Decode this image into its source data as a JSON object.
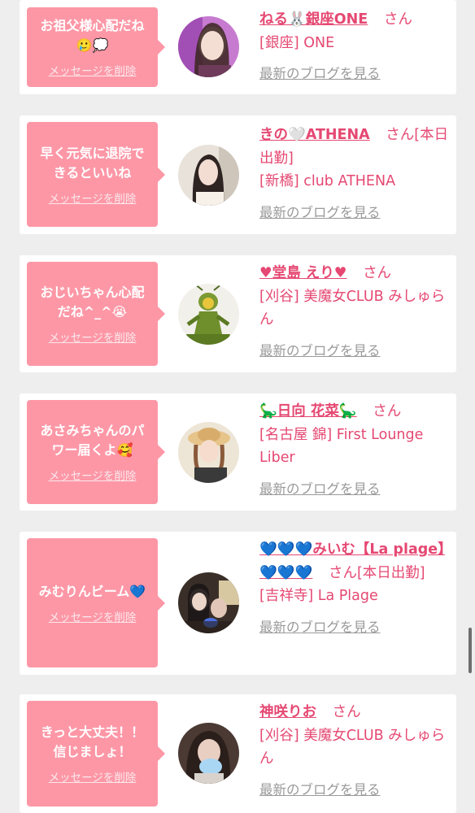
{
  "delete_label": "メッセージを削除",
  "blog_label": "最新のブログを見る",
  "san_label": "さん",
  "colors": {
    "background": "#eeeeee",
    "card": "#ffffff",
    "bubble": "#fd97a6",
    "accent": "#e54872",
    "muted": "#9a9a9a"
  },
  "messages": [
    {
      "text": "お祖父様心配だね\n🥲💭",
      "name": "ねる🐰銀座ONE",
      "after_name": "さん",
      "shop": "[銀座] ONE",
      "avatar_icon": "girl-photo-avatar-icon"
    },
    {
      "text": "早く元気に退院で\nきるといいね",
      "name": "きの🤍ATHENA",
      "after_name": "さん[本日出勤]",
      "shop": "[新橋] club ATHENA",
      "avatar_icon": "girl-photo-avatar-icon"
    },
    {
      "text": "おじいちゃん心配\nだね^_^😭",
      "name": "♥堂島 えり♥",
      "after_name": "さん",
      "shop": "[刈谷] 美魔女CLUB みしゅらん",
      "avatar_icon": "mantis-figure-avatar-icon"
    },
    {
      "text": "あさみちゃんのパ\nワー届くよ🥰",
      "name": "🦕日向 花菜🦕",
      "after_name": "さん",
      "shop": "[名古屋 錦] First Lounge Liber",
      "avatar_icon": "girl-with-hat-avatar-icon"
    },
    {
      "text": "みむりんビーム💙",
      "name": "💙💙💙みいむ【La plage】💙💙💙",
      "after_name": "さん[本日出勤]",
      "shop": "[吉祥寺] La Plage",
      "avatar_icon": "two-girls-avatar-icon"
    },
    {
      "text": "きっと大丈夫！！\n信じましょ！",
      "name": "神咲りお",
      "after_name": "さん",
      "shop": "[刈谷] 美魔女CLUB みしゅらん",
      "avatar_icon": "girl-blurred-avatar-icon"
    }
  ]
}
